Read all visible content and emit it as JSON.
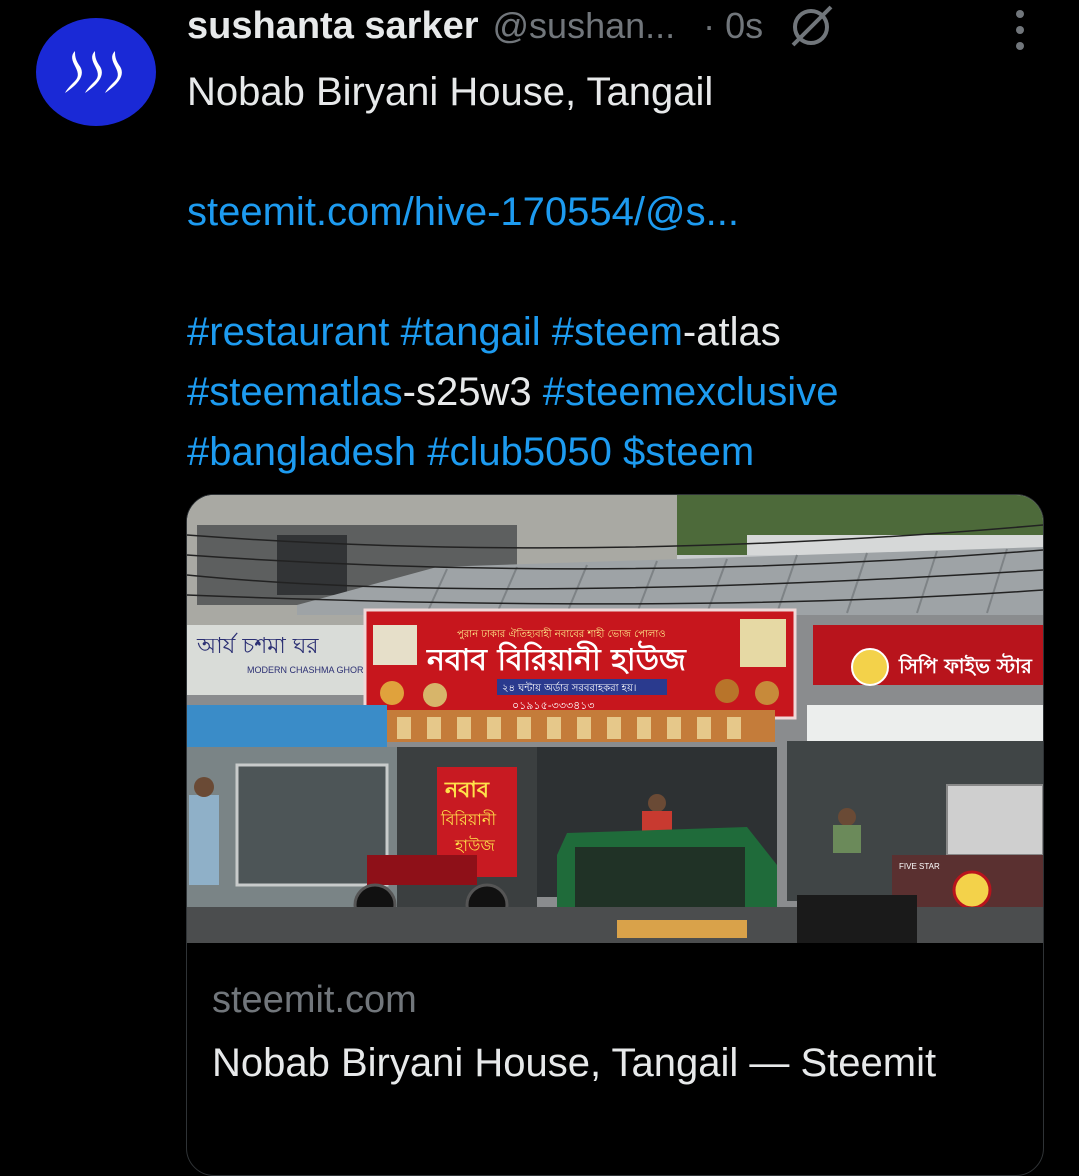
{
  "author": {
    "name": "sushanta sarker",
    "handle": "@sushan...",
    "time": "· 0s",
    "avatar_color": "#1a29d6"
  },
  "tweet": {
    "line1": "Nobab Biryani House, Tangail",
    "link": "steemit.com/hive-170554/@s...",
    "tags": {
      "t1": "#restaurant",
      "t2": "#tangail",
      "t3": "#steem",
      "t3_suffix": "-atlas",
      "t4": "#steematlas",
      "t4_suffix": "-s25w3",
      "t5": "#steemexclusive",
      "t6": "#bangladesh",
      "t7": "#club5050",
      "t8": "$steem"
    }
  },
  "card": {
    "domain": "steemit.com",
    "title": "Nobab Biryani House, Tangail — Steemit",
    "image": {
      "main_sign": "নবাব বিরিয়ানী হাউজ",
      "main_sign_top": "পুরান ঢাকার ঐতিহ্যবাহী নবাবের শাহী ভোজ পোলাও",
      "main_sign_sub": "২৪ ঘন্টায় অর্ডার সরবরাহকরা হয়।",
      "main_sign_phone": "০১৯১৫-৩৩৩৪১৩",
      "right_sign": "সিপি ফাইভ স্টার",
      "left_sign": "আর্য চশমা ঘর",
      "left_sign_sub": "MODERN CHASHMA GHOR",
      "banner": "নবাব",
      "banner2": "বিরিয়ানী",
      "banner3": "হাউজ",
      "stall": "FIVE STAR"
    }
  },
  "icons": {
    "avatar": "steem-logo-icon",
    "grok": "grok-icon",
    "more": "more-vertical-icon"
  },
  "colors": {
    "link": "#1d9bf0",
    "muted": "#71767b",
    "text": "#e7e9ea"
  }
}
